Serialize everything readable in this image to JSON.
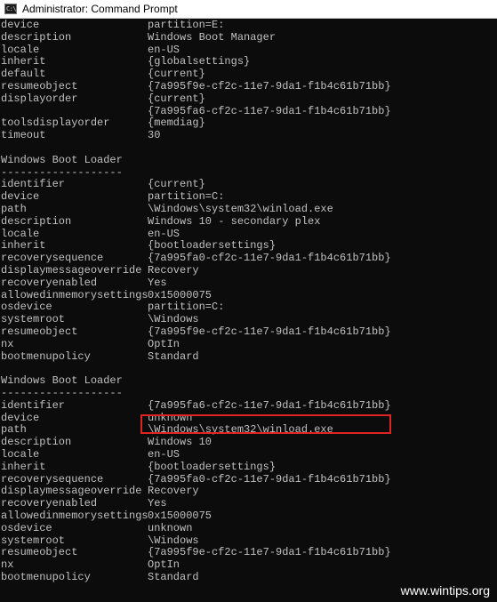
{
  "window": {
    "title": "Administrator: Command Prompt"
  },
  "console": {
    "rows": [
      {
        "key": "device",
        "value": "partition=E:"
      },
      {
        "key": "description",
        "value": "Windows Boot Manager"
      },
      {
        "key": "locale",
        "value": "en-US"
      },
      {
        "key": "inherit",
        "value": "{globalsettings}"
      },
      {
        "key": "default",
        "value": "{current}"
      },
      {
        "key": "resumeobject",
        "value": "{7a995f9e-cf2c-11e7-9da1-f1b4c61b71bb}"
      },
      {
        "key": "displayorder",
        "value": "{current}"
      },
      {
        "key": "",
        "value": "{7a995fa6-cf2c-11e7-9da1-f1b4c61b71bb}"
      },
      {
        "key": "toolsdisplayorder",
        "value": "{memdiag}"
      },
      {
        "key": "timeout",
        "value": "30"
      },
      {
        "key": "",
        "value": ""
      },
      {
        "key": "Windows Boot Loader",
        "value": ""
      },
      {
        "key": "-------------------",
        "value": ""
      },
      {
        "key": "identifier",
        "value": "{current}"
      },
      {
        "key": "device",
        "value": "partition=C:"
      },
      {
        "key": "path",
        "value": "\\Windows\\system32\\winload.exe"
      },
      {
        "key": "description",
        "value": "Windows 10 - secondary plex"
      },
      {
        "key": "locale",
        "value": "en-US"
      },
      {
        "key": "inherit",
        "value": "{bootloadersettings}"
      },
      {
        "key": "recoverysequence",
        "value": "{7a995fa0-cf2c-11e7-9da1-f1b4c61b71bb}"
      },
      {
        "key": "displaymessageoverride",
        "value": "Recovery"
      },
      {
        "key": "recoveryenabled",
        "value": "Yes"
      },
      {
        "key": "allowedinmemorysettings",
        "value": "0x15000075"
      },
      {
        "key": "osdevice",
        "value": "partition=C:"
      },
      {
        "key": "systemroot",
        "value": "\\Windows"
      },
      {
        "key": "resumeobject",
        "value": "{7a995f9e-cf2c-11e7-9da1-f1b4c61b71bb}"
      },
      {
        "key": "nx",
        "value": "OptIn"
      },
      {
        "key": "bootmenupolicy",
        "value": "Standard"
      },
      {
        "key": "",
        "value": ""
      },
      {
        "key": "Windows Boot Loader",
        "value": ""
      },
      {
        "key": "-------------------",
        "value": ""
      },
      {
        "key": "identifier",
        "value": "{7a995fa6-cf2c-11e7-9da1-f1b4c61b71bb}"
      },
      {
        "key": "device",
        "value": "unknown"
      },
      {
        "key": "path",
        "value": "\\Windows\\system32\\winload.exe"
      },
      {
        "key": "description",
        "value": "Windows 10"
      },
      {
        "key": "locale",
        "value": "en-US"
      },
      {
        "key": "inherit",
        "value": "{bootloadersettings}"
      },
      {
        "key": "recoverysequence",
        "value": "{7a995fa0-cf2c-11e7-9da1-f1b4c61b71bb}"
      },
      {
        "key": "displaymessageoverride",
        "value": "Recovery"
      },
      {
        "key": "recoveryenabled",
        "value": "Yes"
      },
      {
        "key": "allowedinmemorysettings",
        "value": "0x15000075"
      },
      {
        "key": "osdevice",
        "value": "unknown"
      },
      {
        "key": "systemroot",
        "value": "\\Windows"
      },
      {
        "key": "resumeobject",
        "value": "{7a995f9e-cf2c-11e7-9da1-f1b4c61b71bb}"
      },
      {
        "key": "nx",
        "value": "OptIn"
      },
      {
        "key": "bootmenupolicy",
        "value": "Standard"
      }
    ]
  },
  "watermark": "www.wintips.org",
  "colors": {
    "console_bg": "#0c0c0c",
    "console_text": "#c0c0c0",
    "highlight": "#e02424"
  }
}
